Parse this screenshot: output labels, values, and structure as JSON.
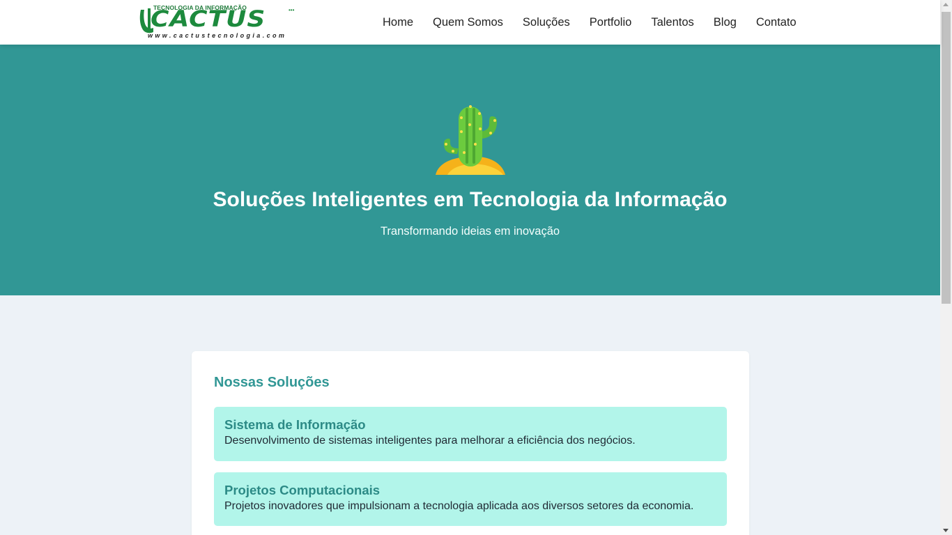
{
  "header": {
    "logo": {
      "tagline": "TECNOLOGIA DA INFORMAÇÃO",
      "wordmark": "CACTUS",
      "url": "www.cactustecnologia.com"
    },
    "nav": [
      {
        "label": "Home"
      },
      {
        "label": "Quem Somos"
      },
      {
        "label": "Soluções"
      },
      {
        "label": "Portfolio"
      },
      {
        "label": "Talentos"
      },
      {
        "label": "Blog"
      },
      {
        "label": "Contato"
      }
    ]
  },
  "hero": {
    "icon": "cactus-icon",
    "title": "Soluções Inteligentes em Tecnologia da Informação",
    "subtitle": "Transformando ideias em inovação",
    "background_color": "#319795"
  },
  "solutions": {
    "title": "Nossas Soluções",
    "items": [
      {
        "title": "Sistema de Informação",
        "description": "Desenvolvimento de sistemas inteligentes para melhorar a eficiência dos negócios."
      },
      {
        "title": "Projetos Computacionais",
        "description": "Projetos inovadores que impulsionam a tecnologia aplicada aos diversos setores da economia."
      }
    ],
    "item_background_color": "#b2f5ea"
  },
  "colors": {
    "accent": "#319795",
    "page_background": "#edf2f7"
  }
}
